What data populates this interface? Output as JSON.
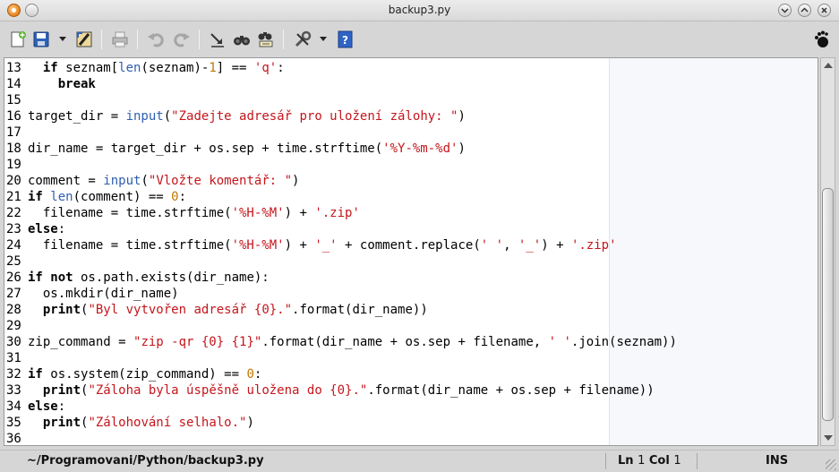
{
  "window": {
    "title": "backup3.py"
  },
  "toolbar": {
    "buttons": [
      "new-file",
      "save",
      "save-dropdown",
      "edit-properties",
      "print",
      "undo",
      "redo",
      "jump",
      "find",
      "replace",
      "tools",
      "tools-dropdown",
      "help"
    ]
  },
  "editor": {
    "lines": [
      {
        "n": "13",
        "tokens": [
          [
            "",
            "  "
          ],
          [
            "kw",
            "if"
          ],
          [
            "",
            " seznam["
          ],
          [
            "fn",
            "len"
          ],
          [
            "",
            "(seznam)-"
          ],
          [
            "num",
            "1"
          ],
          [
            "",
            "] == "
          ],
          [
            "str",
            "'q'"
          ],
          [
            "",
            ":"
          ]
        ]
      },
      {
        "n": "14",
        "tokens": [
          [
            "",
            "    "
          ],
          [
            "kw",
            "break"
          ]
        ]
      },
      {
        "n": "15",
        "tokens": []
      },
      {
        "n": "16",
        "tokens": [
          [
            "",
            "target_dir = "
          ],
          [
            "fn",
            "input"
          ],
          [
            "",
            "("
          ],
          [
            "str",
            "\"Zadejte adresář pro uložení zálohy: \""
          ],
          [
            "",
            ")"
          ]
        ]
      },
      {
        "n": "17",
        "tokens": []
      },
      {
        "n": "18",
        "tokens": [
          [
            "",
            "dir_name = target_dir + os.sep + time.strftime("
          ],
          [
            "str",
            "'%Y-%m-%d'"
          ],
          [
            "",
            ")"
          ]
        ]
      },
      {
        "n": "19",
        "tokens": []
      },
      {
        "n": "20",
        "tokens": [
          [
            "",
            "comment = "
          ],
          [
            "fn",
            "input"
          ],
          [
            "",
            "("
          ],
          [
            "str",
            "\"Vložte komentář: \""
          ],
          [
            "",
            ")"
          ]
        ]
      },
      {
        "n": "21",
        "tokens": [
          [
            "kw",
            "if"
          ],
          [
            "",
            " "
          ],
          [
            "fn",
            "len"
          ],
          [
            "",
            "(comment) == "
          ],
          [
            "num",
            "0"
          ],
          [
            "",
            ":"
          ]
        ]
      },
      {
        "n": "22",
        "tokens": [
          [
            "",
            "  filename = time.strftime("
          ],
          [
            "str",
            "'%H-%M'"
          ],
          [
            "",
            ") + "
          ],
          [
            "str",
            "'.zip'"
          ]
        ]
      },
      {
        "n": "23",
        "tokens": [
          [
            "kw",
            "else"
          ],
          [
            "",
            ":"
          ]
        ]
      },
      {
        "n": "24",
        "tokens": [
          [
            "",
            "  filename = time.strftime("
          ],
          [
            "str",
            "'%H-%M'"
          ],
          [
            "",
            ") + "
          ],
          [
            "str",
            "'_'"
          ],
          [
            "",
            " + comment.replace("
          ],
          [
            "str",
            "' '"
          ],
          [
            "",
            ", "
          ],
          [
            "str",
            "'_'"
          ],
          [
            "",
            ") + "
          ],
          [
            "str",
            "'.zip'"
          ]
        ]
      },
      {
        "n": "25",
        "tokens": []
      },
      {
        "n": "26",
        "tokens": [
          [
            "kw",
            "if not"
          ],
          [
            "",
            " os.path.exists(dir_name):"
          ]
        ]
      },
      {
        "n": "27",
        "tokens": [
          [
            "",
            "  os.mkdir(dir_name)"
          ]
        ]
      },
      {
        "n": "28",
        "tokens": [
          [
            "",
            "  "
          ],
          [
            "kw",
            "print"
          ],
          [
            "",
            "("
          ],
          [
            "str",
            "\"Byl vytvořen adresář {0}.\""
          ],
          [
            "",
            ".format(dir_name))"
          ]
        ]
      },
      {
        "n": "29",
        "tokens": []
      },
      {
        "n": "30",
        "tokens": [
          [
            "",
            "zip_command = "
          ],
          [
            "str",
            "\"zip -qr {0} {1}\""
          ],
          [
            "",
            ".format(dir_name + os.sep + filename, "
          ],
          [
            "str",
            "' '"
          ],
          [
            "",
            ".join(seznam))"
          ]
        ]
      },
      {
        "n": "31",
        "tokens": []
      },
      {
        "n": "32",
        "tokens": [
          [
            "kw",
            "if"
          ],
          [
            "",
            " os.system(zip_command) == "
          ],
          [
            "num",
            "0"
          ],
          [
            "",
            ":"
          ]
        ]
      },
      {
        "n": "33",
        "tokens": [
          [
            "",
            "  "
          ],
          [
            "kw",
            "print"
          ],
          [
            "",
            "("
          ],
          [
            "str",
            "\"Záloha byla úspěšně uložena do {0}.\""
          ],
          [
            "",
            ".format(dir_name + os.sep + filename))"
          ]
        ]
      },
      {
        "n": "34",
        "tokens": [
          [
            "kw",
            "else"
          ],
          [
            "",
            ":"
          ]
        ]
      },
      {
        "n": "35",
        "tokens": [
          [
            "",
            "  "
          ],
          [
            "kw",
            "print"
          ],
          [
            "",
            "("
          ],
          [
            "str",
            "\"Zálohování selhalo.\""
          ],
          [
            "",
            ")"
          ]
        ]
      },
      {
        "n": "36",
        "tokens": []
      }
    ]
  },
  "status": {
    "path": "~/Programovani/Python/backup3.py",
    "ln_label": "Ln",
    "ln": "1",
    "col_label": "Col",
    "col": "1",
    "mode": "INS"
  }
}
